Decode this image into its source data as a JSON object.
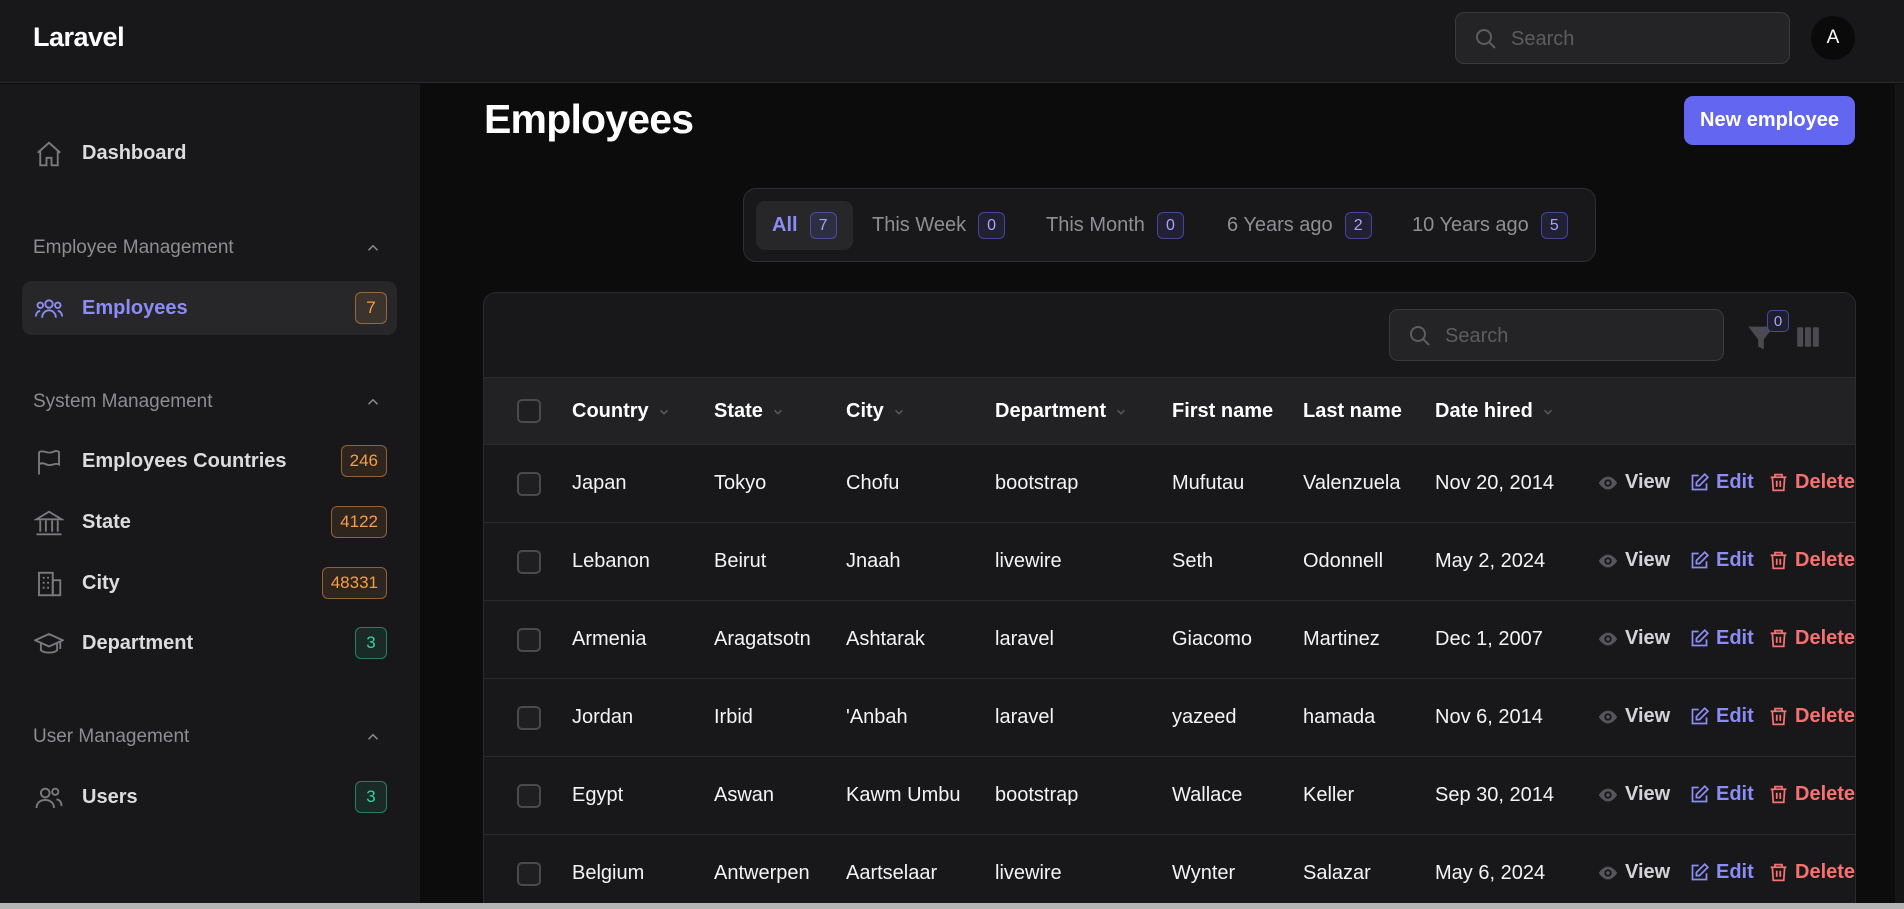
{
  "brand": "Laravel",
  "top_search_placeholder": "Search",
  "avatar_initial": "A",
  "sidebar": {
    "dashboard": "Dashboard",
    "groups": [
      {
        "title": "Employee Management",
        "items": [
          {
            "label": "Employees",
            "count": "7",
            "color": "orange"
          }
        ]
      },
      {
        "title": "System Management",
        "items": [
          {
            "label": "Employees Countries",
            "count": "246",
            "color": "orange"
          },
          {
            "label": "State",
            "count": "4122",
            "color": "orange"
          },
          {
            "label": "City",
            "count": "48331",
            "color": "orange"
          },
          {
            "label": "Department",
            "count": "3",
            "color": "green"
          }
        ]
      },
      {
        "title": "User Management",
        "items": [
          {
            "label": "Users",
            "count": "3",
            "color": "green"
          }
        ]
      }
    ]
  },
  "page": {
    "title": "Employees",
    "new_button": "New employee"
  },
  "tabs": [
    {
      "label": "All",
      "count": "7"
    },
    {
      "label": "This Week",
      "count": "0"
    },
    {
      "label": "This Month",
      "count": "0"
    },
    {
      "label": "6 Years ago",
      "count": "2"
    },
    {
      "label": "10 Years ago",
      "count": "5"
    }
  ],
  "table": {
    "search_placeholder": "Search",
    "filter_count": "0",
    "columns": [
      "Country",
      "State",
      "City",
      "Department",
      "First name",
      "Last name",
      "Date hired"
    ],
    "actions": {
      "view": "View",
      "edit": "Edit",
      "delete": "Delete"
    },
    "rows": [
      [
        "Japan",
        "Tokyo",
        "Chofu",
        "bootstrap",
        "Mufutau",
        "Valenzuela",
        "Nov 20, 2014"
      ],
      [
        "Lebanon",
        "Beirut",
        "Jnaah",
        "livewire",
        "Seth",
        "Odonnell",
        "May 2, 2024"
      ],
      [
        "Armenia",
        "Aragatsotn",
        "Ashtarak",
        "laravel",
        "Giacomo",
        "Martinez",
        "Dec 1, 2007"
      ],
      [
        "Jordan",
        "Irbid",
        "'Anbah",
        "laravel",
        "yazeed",
        "hamada",
        "Nov 6, 2014"
      ],
      [
        "Egypt",
        "Aswan",
        "Kawm Umbu",
        "bootstrap",
        "Wallace",
        "Keller",
        "Sep 30, 2014"
      ],
      [
        "Belgium",
        "Antwerpen",
        "Aartselaar",
        "livewire",
        "Wynter",
        "Salazar",
        "May 6, 2024"
      ]
    ]
  },
  "colors": {
    "accent": "#6366f1",
    "danger": "#f87171",
    "warning": "#f59e47",
    "success": "#34d399"
  }
}
